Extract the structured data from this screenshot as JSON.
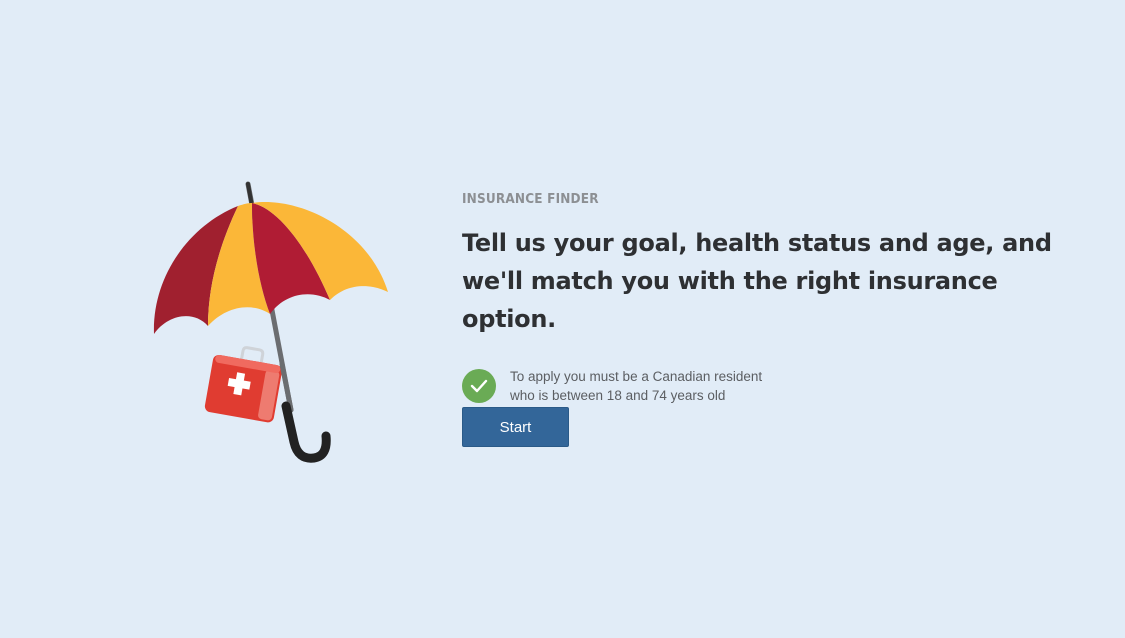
{
  "page": {
    "background": "#e1ecf7"
  },
  "illustration": {
    "icon": "umbrella-with-first-aid-kit-icon",
    "colors": {
      "umbrella_red": "#a91c32",
      "umbrella_yellow": "#fbb738",
      "kit_red": "#e03c31",
      "handle": "#222222"
    }
  },
  "intro": {
    "eyebrow": "INSURANCE FINDER",
    "headline": "Tell us your goal, health status and age, and we'll match you with the right insurance option.",
    "eligibility": {
      "icon": "check-circle-icon",
      "line1": "To apply you must be a Canadian resident",
      "line2": "who is between 18 and 74 years old"
    },
    "start_label": "Start"
  },
  "colors": {
    "accent": "#336699",
    "check": "#6aab55",
    "headline": "#2e3033",
    "eyebrow": "#8c8f93"
  }
}
